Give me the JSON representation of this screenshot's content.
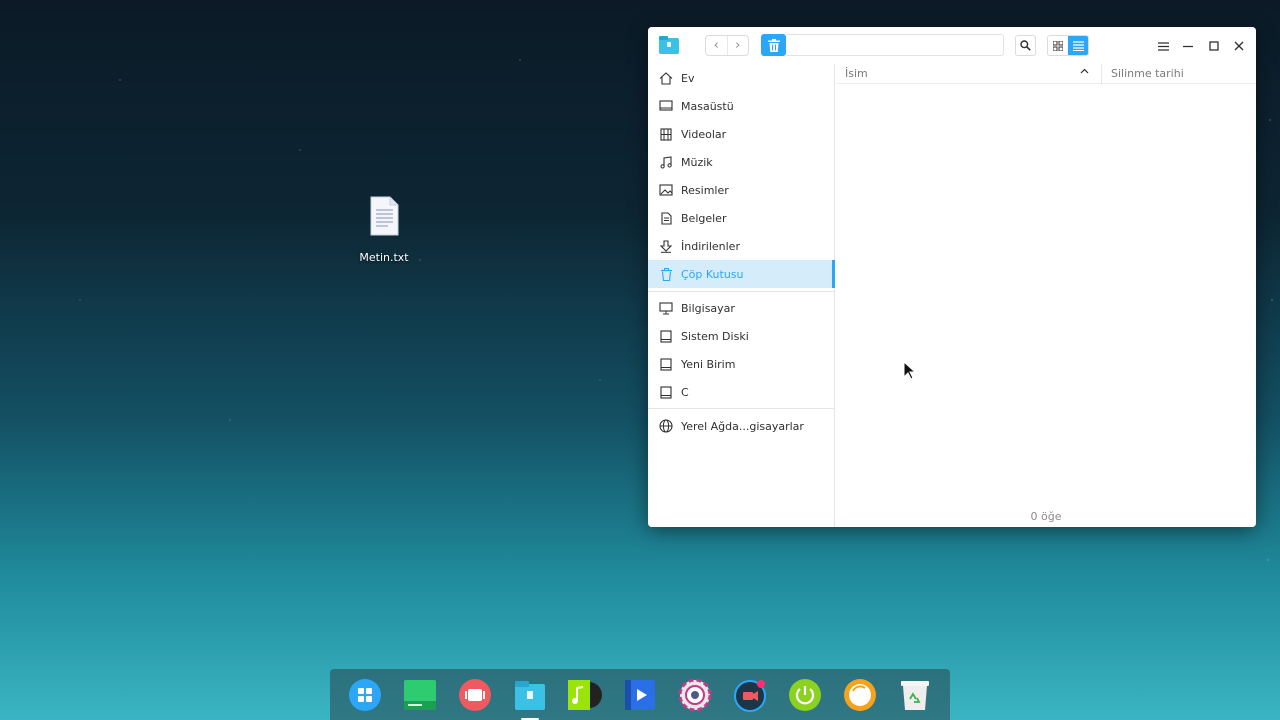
{
  "desktop": {
    "icons": [
      {
        "label": "Metin.txt",
        "icon": "text-file-icon"
      }
    ]
  },
  "file_manager": {
    "toolbar": {
      "back_glyph": "‹",
      "forward_glyph": "›",
      "address_value": "",
      "active_view": "list"
    },
    "sidebar": {
      "items": [
        {
          "label": "Ev",
          "icon": "home-icon"
        },
        {
          "label": "Masaüstü",
          "icon": "desktop-icon"
        },
        {
          "label": "Videolar",
          "icon": "videos-icon"
        },
        {
          "label": "Müzik",
          "icon": "music-icon"
        },
        {
          "label": "Resimler",
          "icon": "pictures-icon"
        },
        {
          "label": "Belgeler",
          "icon": "documents-icon"
        },
        {
          "label": "İndirilenler",
          "icon": "downloads-icon"
        },
        {
          "label": "Çöp Kutusu",
          "icon": "trash-icon",
          "active": true
        },
        {
          "label": "Bilgisayar",
          "icon": "computer-icon"
        },
        {
          "label": "Sistem Diski",
          "icon": "disk-icon"
        },
        {
          "label": "Yeni Birim",
          "icon": "disk-icon"
        },
        {
          "label": "C",
          "icon": "disk-icon"
        },
        {
          "label": "Yerel Ağda...gisayarlar",
          "icon": "network-icon"
        }
      ]
    },
    "columns": {
      "name": "İsim",
      "deleted_date": "Silinme tarihi",
      "sort_glyph": "^"
    },
    "status": "0 öğe"
  },
  "dock": {
    "apps": [
      {
        "name": "launcher",
        "color": "#2ca7f8"
      },
      {
        "name": "terminal",
        "color": "#2ecc71"
      },
      {
        "name": "screenshot",
        "color": "#f0595f"
      },
      {
        "name": "file-manager",
        "color": "#3bc0e6",
        "running": true
      },
      {
        "name": "music",
        "color": "#9be40b"
      },
      {
        "name": "movie",
        "color": "#2a6ee8"
      },
      {
        "name": "settings",
        "color": "#e8e8e8"
      },
      {
        "name": "screen-recorder",
        "color": "#2ca7f8"
      },
      {
        "name": "shutdown",
        "color": "#8bd11f"
      },
      {
        "name": "deepin-app",
        "color": "#f7a21b"
      },
      {
        "name": "trash",
        "color": "#eeeeee"
      }
    ]
  },
  "colors": {
    "accent": "#2ca7f8",
    "selection_bg": "#d5ecfb"
  }
}
